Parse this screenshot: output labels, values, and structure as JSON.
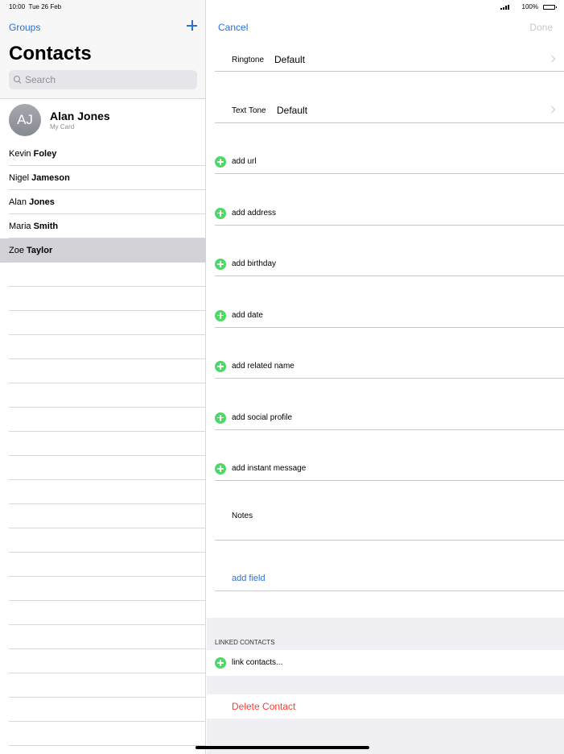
{
  "status_bar": {
    "time": "10:00",
    "date": "Tue 26 Feb",
    "battery": "100%",
    "battery_level": 1.0
  },
  "left_pane": {
    "groups_label": "Groups",
    "title": "Contacts",
    "search_placeholder": "Search",
    "my_card": {
      "initials": "AJ",
      "name": "Alan Jones",
      "label": "My Card"
    },
    "contacts": [
      {
        "first": "Kevin",
        "last": "Foley",
        "selected": false
      },
      {
        "first": "Nigel",
        "last": "Jameson",
        "selected": false
      },
      {
        "first": "Alan",
        "last": "Jones",
        "selected": false
      },
      {
        "first": "Maria",
        "last": "Smith",
        "selected": false
      },
      {
        "first": "Zoe",
        "last": "Taylor",
        "selected": true
      }
    ]
  },
  "right_pane": {
    "cancel_label": "Cancel",
    "done_label": "Done",
    "ringtone": {
      "label": "Ringtone",
      "value": "Default"
    },
    "text_tone": {
      "label": "Text Tone",
      "value": "Default"
    },
    "add_fields": [
      "add url",
      "add address",
      "add birthday",
      "add date",
      "add related name",
      "add social profile",
      "add instant message"
    ],
    "notes_label": "Notes",
    "add_field_label": "add field",
    "linked_contacts_header": "LINKED CONTACTS",
    "link_contacts_label": "link contacts...",
    "delete_label": "Delete Contact"
  },
  "colors": {
    "accent": "#2b6fd6",
    "add_green": "#4cd964",
    "destructive": "#ff3b30",
    "selected_row": "#d1d1d6"
  },
  "icons": [
    "search-icon",
    "plus-icon",
    "add-circle-icon",
    "chevron-right-icon",
    "signal-icon",
    "battery-icon"
  ]
}
